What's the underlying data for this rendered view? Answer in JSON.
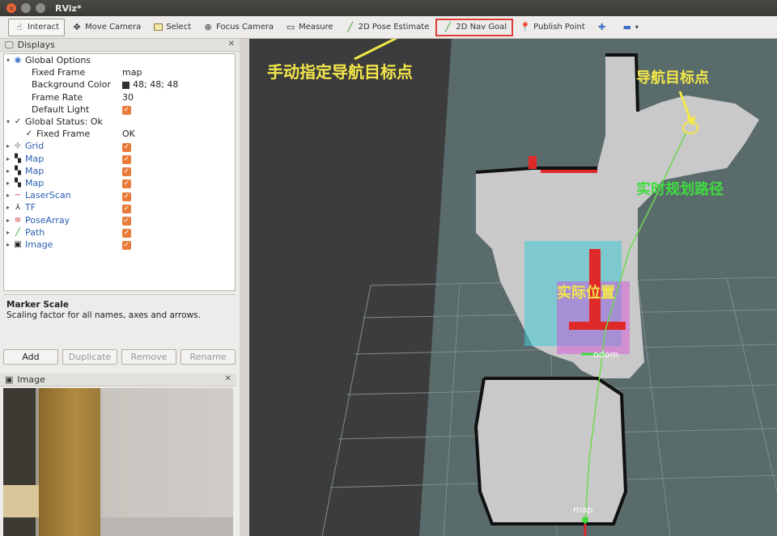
{
  "window": {
    "title": "RViz*"
  },
  "toolbar": {
    "tools": [
      {
        "label": "Interact",
        "icon": "cursor-icon"
      },
      {
        "label": "Move Camera",
        "icon": "move-camera-icon"
      },
      {
        "label": "Select",
        "icon": "select-icon"
      },
      {
        "label": "Focus Camera",
        "icon": "focus-camera-icon"
      },
      {
        "label": "Measure",
        "icon": "measure-icon"
      },
      {
        "label": "2D Pose Estimate",
        "icon": "pose-estimate-icon"
      },
      {
        "label": "2D Nav Goal",
        "icon": "nav-goal-icon"
      },
      {
        "label": "Publish Point",
        "icon": "publish-point-icon"
      }
    ]
  },
  "displays": {
    "title": "Displays",
    "global_options": "Global Options",
    "fixed_frame_label": "Fixed Frame",
    "fixed_frame_value": "map",
    "bg_color_label": "Background Color",
    "bg_color_value": "48; 48; 48",
    "frame_rate_label": "Frame Rate",
    "frame_rate_value": "30",
    "default_light_label": "Default Light",
    "global_status": "Global Status: Ok",
    "fixed_frame_status_label": "Fixed Frame",
    "fixed_frame_status_value": "OK",
    "items": [
      {
        "name": "Grid",
        "icon": "grid-icon"
      },
      {
        "name": "Map",
        "icon": "map-icon"
      },
      {
        "name": "Map",
        "icon": "map-icon"
      },
      {
        "name": "Map",
        "icon": "map-icon"
      },
      {
        "name": "LaserScan",
        "icon": "laserscan-icon"
      },
      {
        "name": "TF",
        "icon": "tf-icon"
      },
      {
        "name": "PoseArray",
        "icon": "posearray-icon"
      },
      {
        "name": "Path",
        "icon": "path-icon"
      },
      {
        "name": "Image",
        "icon": "image-icon"
      }
    ]
  },
  "description": {
    "title": "Marker Scale",
    "text": "Scaling factor for all names, axes and arrows."
  },
  "buttons": {
    "add": "Add",
    "duplicate": "Duplicate",
    "remove": "Remove",
    "rename": "Rename"
  },
  "image_panel": {
    "title": "Image"
  },
  "viewport": {
    "frame_labels": {
      "odom": "odom",
      "map": "map"
    },
    "annotations": {
      "manual_goal": "手动指定导航目标点",
      "nav_goal": "导航目标点",
      "realtime_path": "实时规划路径",
      "actual_position": "实际位置"
    }
  },
  "colors": {
    "accent_red": "#e23a3a",
    "annotation_yellow": "#f3e74a",
    "annotation_green": "#3fdc3f",
    "checkbox": "#e87b3a"
  }
}
